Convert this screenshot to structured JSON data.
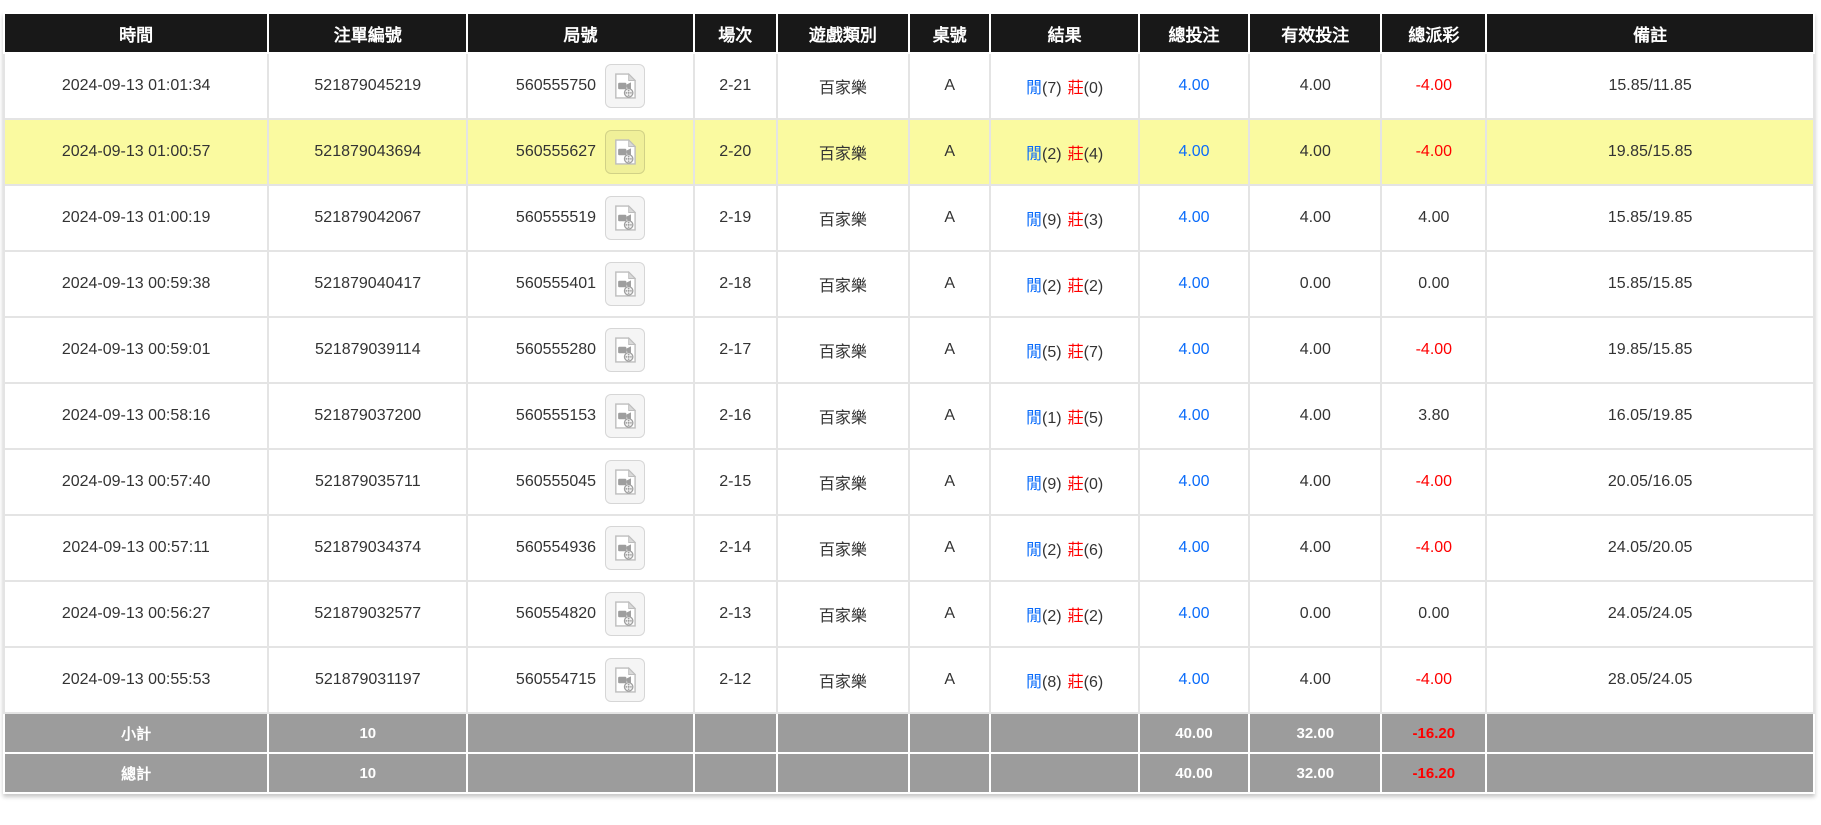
{
  "colors": {
    "header_bg": "#181818",
    "header_text": "#ffffff",
    "highlight_row_bg": "#fafaa0",
    "player_and_bet_blue": "#0b6cfa",
    "banker_and_negative_red": "#ff0000",
    "footer_bg": "#9c9c9c",
    "body_text": "#333333"
  },
  "table": {
    "headers": [
      "時間",
      "注單編號",
      "局號",
      "場次",
      "遊戲類別",
      "桌號",
      "結果",
      "總投注",
      "有效投注",
      "總派彩",
      "備註"
    ],
    "result_labels": {
      "player": "閒",
      "banker": "莊"
    },
    "rows": [
      {
        "time": "2024-09-13 01:01:34",
        "bet_id": "521879045219",
        "round_id": "560555750",
        "session": "2-21",
        "game_type": "百家樂",
        "table_no": "A",
        "player_score": "(7)",
        "banker_score": "(0)",
        "total_bet": "4.00",
        "valid_bet": "4.00",
        "total_payout": "-4.00",
        "remark": "15.85/11.85",
        "highlighted": false
      },
      {
        "time": "2024-09-13 01:00:57",
        "bet_id": "521879043694",
        "round_id": "560555627",
        "session": "2-20",
        "game_type": "百家樂",
        "table_no": "A",
        "player_score": "(2)",
        "banker_score": "(4)",
        "total_bet": "4.00",
        "valid_bet": "4.00",
        "total_payout": "-4.00",
        "remark": "19.85/15.85",
        "highlighted": true
      },
      {
        "time": "2024-09-13 01:00:19",
        "bet_id": "521879042067",
        "round_id": "560555519",
        "session": "2-19",
        "game_type": "百家樂",
        "table_no": "A",
        "player_score": "(9)",
        "banker_score": "(3)",
        "total_bet": "4.00",
        "valid_bet": "4.00",
        "total_payout": "4.00",
        "remark": "15.85/19.85",
        "highlighted": false
      },
      {
        "time": "2024-09-13 00:59:38",
        "bet_id": "521879040417",
        "round_id": "560555401",
        "session": "2-18",
        "game_type": "百家樂",
        "table_no": "A",
        "player_score": "(2)",
        "banker_score": "(2)",
        "total_bet": "4.00",
        "valid_bet": "0.00",
        "total_payout": "0.00",
        "remark": "15.85/15.85",
        "highlighted": false
      },
      {
        "time": "2024-09-13 00:59:01",
        "bet_id": "521879039114",
        "round_id": "560555280",
        "session": "2-17",
        "game_type": "百家樂",
        "table_no": "A",
        "player_score": "(5)",
        "banker_score": "(7)",
        "total_bet": "4.00",
        "valid_bet": "4.00",
        "total_payout": "-4.00",
        "remark": "19.85/15.85",
        "highlighted": false
      },
      {
        "time": "2024-09-13 00:58:16",
        "bet_id": "521879037200",
        "round_id": "560555153",
        "session": "2-16",
        "game_type": "百家樂",
        "table_no": "A",
        "player_score": "(1)",
        "banker_score": "(5)",
        "total_bet": "4.00",
        "valid_bet": "4.00",
        "total_payout": "3.80",
        "remark": "16.05/19.85",
        "highlighted": false
      },
      {
        "time": "2024-09-13 00:57:40",
        "bet_id": "521879035711",
        "round_id": "560555045",
        "session": "2-15",
        "game_type": "百家樂",
        "table_no": "A",
        "player_score": "(9)",
        "banker_score": "(0)",
        "total_bet": "4.00",
        "valid_bet": "4.00",
        "total_payout": "-4.00",
        "remark": "20.05/16.05",
        "highlighted": false
      },
      {
        "time": "2024-09-13 00:57:11",
        "bet_id": "521879034374",
        "round_id": "560554936",
        "session": "2-14",
        "game_type": "百家樂",
        "table_no": "A",
        "player_score": "(2)",
        "banker_score": "(6)",
        "total_bet": "4.00",
        "valid_bet": "4.00",
        "total_payout": "-4.00",
        "remark": "24.05/20.05",
        "highlighted": false
      },
      {
        "time": "2024-09-13 00:56:27",
        "bet_id": "521879032577",
        "round_id": "560554820",
        "session": "2-13",
        "game_type": "百家樂",
        "table_no": "A",
        "player_score": "(2)",
        "banker_score": "(2)",
        "total_bet": "4.00",
        "valid_bet": "0.00",
        "total_payout": "0.00",
        "remark": "24.05/24.05",
        "highlighted": false
      },
      {
        "time": "2024-09-13 00:55:53",
        "bet_id": "521879031197",
        "round_id": "560554715",
        "session": "2-12",
        "game_type": "百家樂",
        "table_no": "A",
        "player_score": "(8)",
        "banker_score": "(6)",
        "total_bet": "4.00",
        "valid_bet": "4.00",
        "total_payout": "-4.00",
        "remark": "28.05/24.05",
        "highlighted": false
      }
    ],
    "footer": [
      {
        "label": "小計",
        "count": "10",
        "total_bet": "40.00",
        "valid_bet": "32.00",
        "total_payout": "-16.20"
      },
      {
        "label": "總計",
        "count": "10",
        "total_bet": "40.00",
        "valid_bet": "32.00",
        "total_payout": "-16.20"
      }
    ]
  }
}
